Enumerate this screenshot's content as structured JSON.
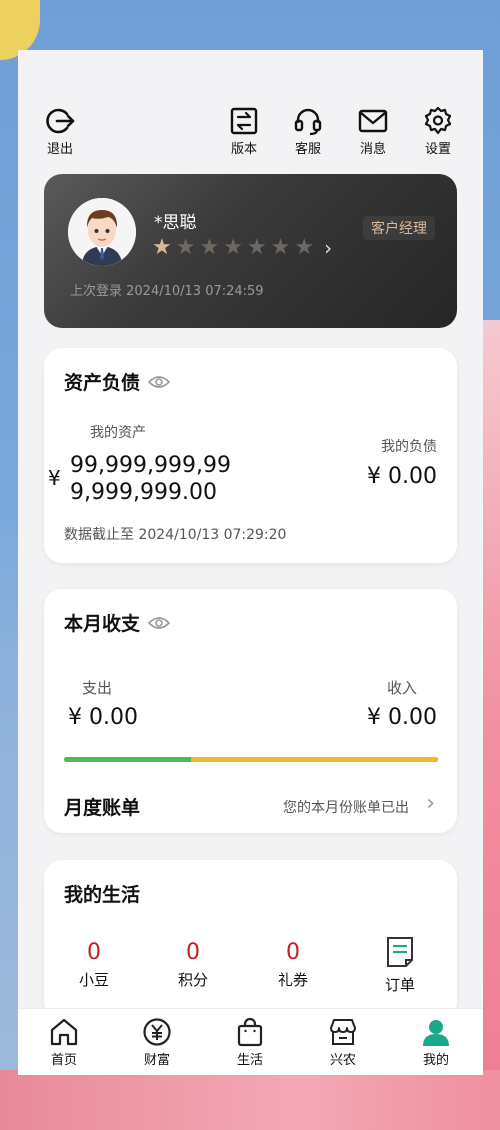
{
  "topbar": {
    "logout": "退出",
    "version": "版本",
    "service": "客服",
    "messages": "消息",
    "settings": "设置"
  },
  "profile": {
    "name": "*思聪",
    "badge": "客户经理",
    "stars_total": 7,
    "stars_filled": 1,
    "last_login": "上次登录 2024/10/13 07:24:59"
  },
  "assets": {
    "title": "资产负债",
    "my_assets_label": "我的资产",
    "currency": "¥",
    "assets_line1": "99,999,999,99",
    "assets_line2": "9,999,999.00",
    "my_liab_label": "我的负债",
    "liab_value": "¥ 0.00",
    "as_of": "数据截止至 2024/10/13 07:29:20"
  },
  "monthly": {
    "title": "本月收支",
    "expense_label": "支出",
    "expense_value": "¥ 0.00",
    "income_label": "收入",
    "income_value": "¥ 0.00",
    "bill_title": "月度账单",
    "bill_hint": "您的本月份账单已出",
    "colors": {
      "expense": "#4cbb55",
      "income": "#ecb930"
    }
  },
  "life": {
    "title": "我的生活",
    "items": [
      {
        "value": "0",
        "label": "小豆"
      },
      {
        "value": "0",
        "label": "积分"
      },
      {
        "value": "0",
        "label": "礼券"
      }
    ],
    "orders_label": "订单"
  },
  "nav": {
    "home": "首页",
    "wealth": "财富",
    "life": "生活",
    "agri": "兴农",
    "mine": "我的",
    "active_color": "#19a98a"
  }
}
